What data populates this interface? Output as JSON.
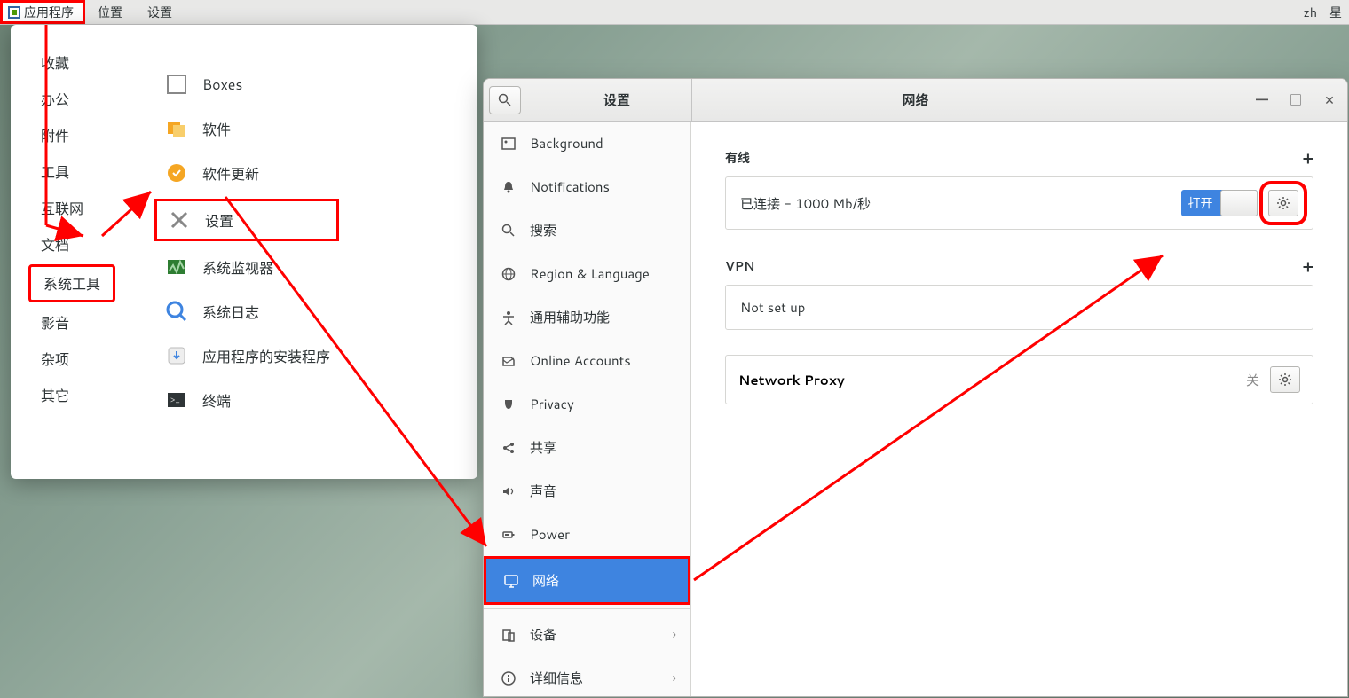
{
  "topbar": {
    "app_menu": "应用程序",
    "places": "位置",
    "settings": "设置",
    "lang": "zh",
    "day": "星"
  },
  "app_menu": {
    "categories": [
      "收藏",
      "办公",
      "附件",
      "工具",
      "互联网",
      "文档",
      "系统工具",
      "影音",
      "杂项",
      "其它"
    ],
    "highlight_category_index": 6,
    "apps": [
      "Boxes",
      "软件",
      "软件更新",
      "设置",
      "系统监视器",
      "系统日志",
      "应用程序的安装程序",
      "终端"
    ],
    "highlight_app_index": 3
  },
  "settings_window": {
    "tb_left": "设置",
    "tb_center": "网络",
    "sidebar": {
      "items": [
        {
          "icon": "background",
          "label": "Background"
        },
        {
          "icon": "bell",
          "label": "Notifications"
        },
        {
          "icon": "search",
          "label": "搜索"
        },
        {
          "icon": "globe",
          "label": "Region & Language"
        },
        {
          "icon": "a11y",
          "label": "通用辅助功能"
        },
        {
          "icon": "accounts",
          "label": "Online Accounts"
        },
        {
          "icon": "privacy",
          "label": "Privacy"
        },
        {
          "icon": "share",
          "label": "共享"
        },
        {
          "icon": "sound",
          "label": "声音"
        },
        {
          "icon": "power",
          "label": "Power"
        },
        {
          "icon": "network",
          "label": "网络",
          "selected": true
        },
        {
          "icon": "devices",
          "label": "设备",
          "chev": true,
          "divider_before": true
        },
        {
          "icon": "info",
          "label": "详细信息",
          "chev": true
        }
      ]
    },
    "content": {
      "wired": {
        "header": "有线",
        "status": "已连接 - 1000 Mb/秒",
        "switch_on_label": "打开"
      },
      "vpn": {
        "header": "VPN",
        "status": "Not set up"
      },
      "proxy": {
        "label": "Network Proxy",
        "state": "关"
      }
    }
  }
}
